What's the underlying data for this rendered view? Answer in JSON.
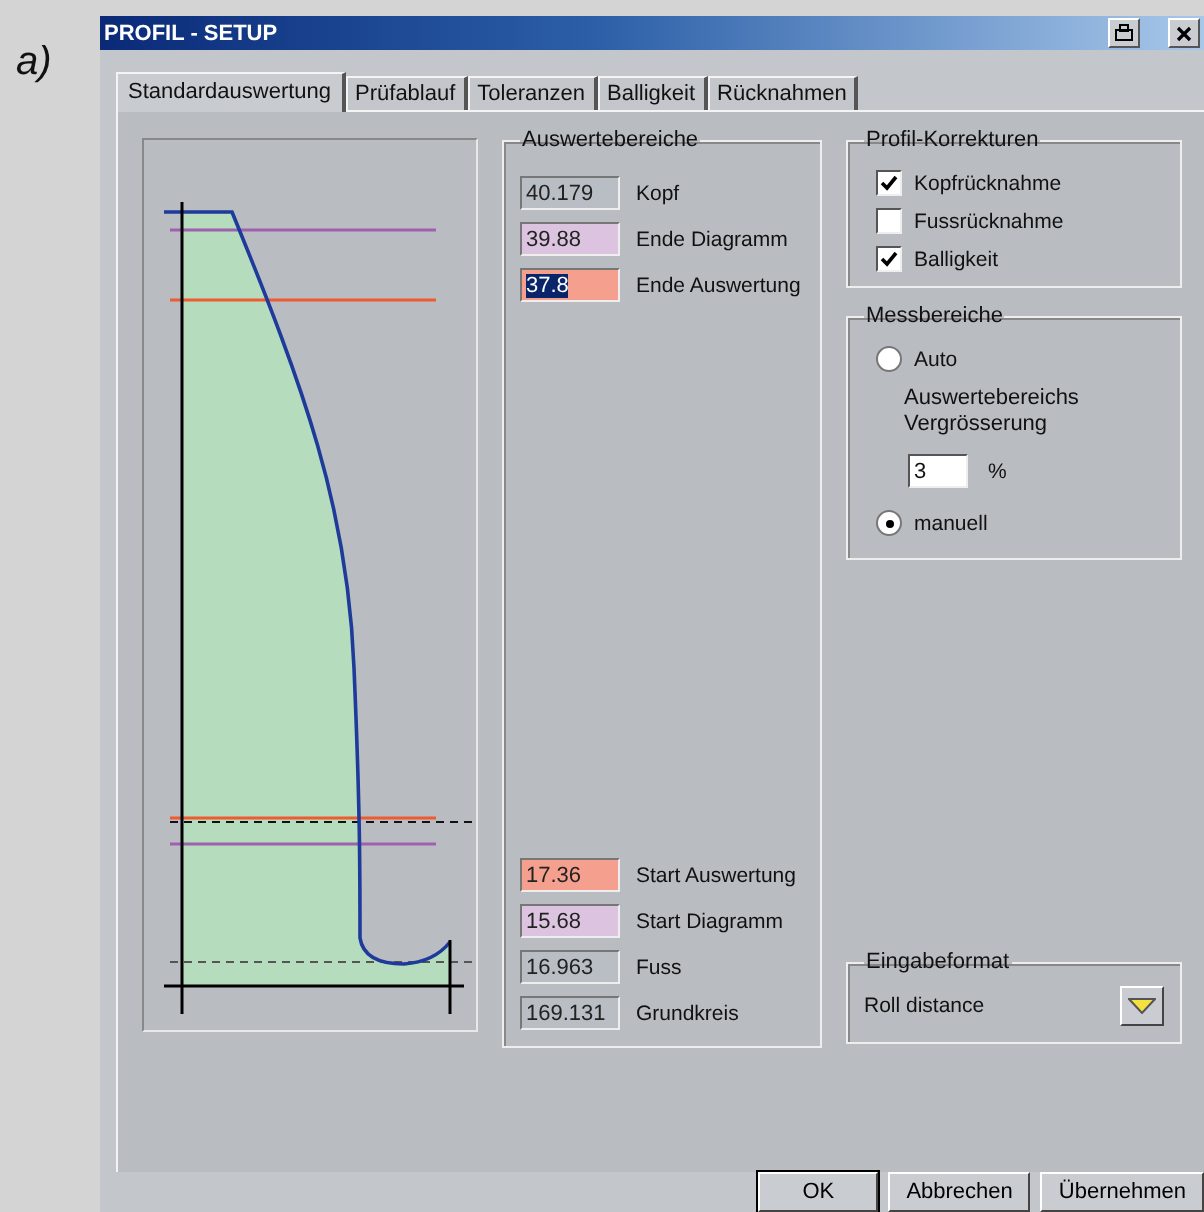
{
  "figure_label": "a)",
  "window": {
    "title": "PROFIL - SETUP"
  },
  "tabs": [
    {
      "label": "Standardauswertung",
      "selected": true
    },
    {
      "label": "Prüfablauf",
      "selected": false
    },
    {
      "label": "Toleranzen",
      "selected": false
    },
    {
      "label": "Balligkeit",
      "selected": false
    },
    {
      "label": "Rücknahmen",
      "selected": false
    }
  ],
  "auswertebereiche": {
    "title": "Auswertebereiche",
    "top_fields": [
      {
        "value": "40.179",
        "label": "Kopf",
        "color": "#b9bec4",
        "selected": false
      },
      {
        "value": "39.88",
        "label": "Ende Diagramm",
        "color": "#dcc4e0",
        "selected": false
      },
      {
        "value": "37.8",
        "label": "Ende Auswertung",
        "color": "#f5a08e",
        "selected": true
      }
    ],
    "bottom_fields": [
      {
        "value": "17.36",
        "label": "Start Auswertung",
        "color": "#f5a08e",
        "selected": false
      },
      {
        "value": "15.68",
        "label": "Start Diagramm",
        "color": "#dcc4e0",
        "selected": false
      },
      {
        "value": "16.963",
        "label": "Fuss",
        "color": "#b9bec4",
        "selected": false
      },
      {
        "value": "169.131",
        "label": "Grundkreis",
        "color": "#b9bec4",
        "selected": false
      }
    ]
  },
  "profil_korrekturen": {
    "title": "Profil-Korrekturen",
    "options": [
      {
        "label": "Kopfrücknahme",
        "checked": true
      },
      {
        "label": "Fussrücknahme",
        "checked": false
      },
      {
        "label": "Balligkeit",
        "checked": true
      }
    ]
  },
  "messbereiche": {
    "title": "Messbereiche",
    "radios": [
      {
        "label": "Auto",
        "selected": false
      },
      {
        "label": "manuell",
        "selected": true
      }
    ],
    "hint": "Auswertebereichs Vergrösserung",
    "zoom_value": "3",
    "unit": "%"
  },
  "eingabeformat": {
    "title": "Eingabeformat",
    "value": "Roll distance"
  },
  "buttons": [
    "OK",
    "Abbrechen",
    "Übernehmen"
  ]
}
